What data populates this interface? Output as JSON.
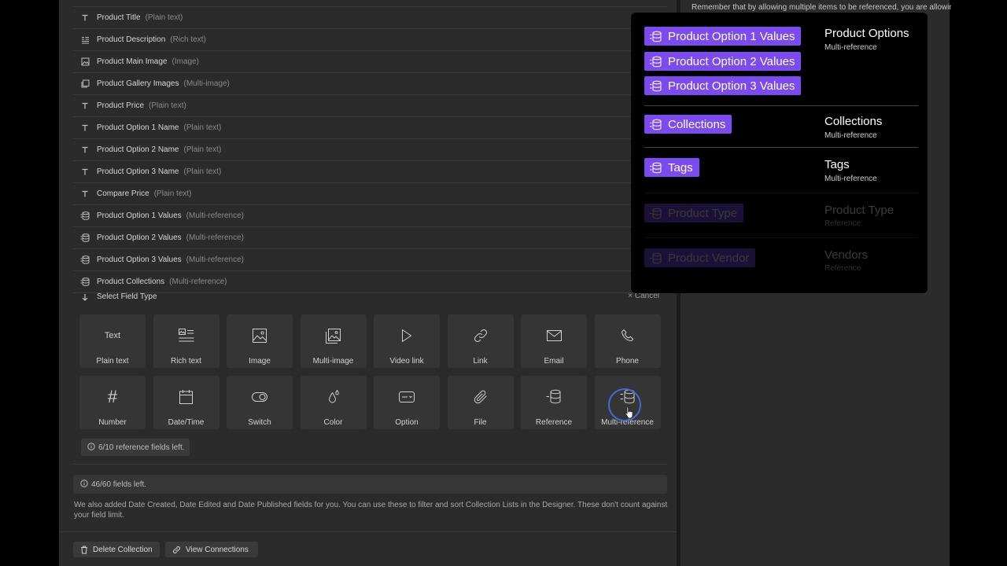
{
  "hint": "Remember that by allowing multiple items to be referenced, you are allowing ... design t",
  "fields": [
    {
      "icon": "text-icon",
      "name": "Product Title",
      "type": "(Plain text)"
    },
    {
      "icon": "rich-text-icon",
      "name": "Product Description",
      "type": "(Rich text)"
    },
    {
      "icon": "image-icon",
      "name": "Product Main Image",
      "type": "(Image)"
    },
    {
      "icon": "multi-image-icon",
      "name": "Product Gallery Images",
      "type": "(Multi-image)"
    },
    {
      "icon": "text-icon",
      "name": "Product Price",
      "type": "(Plain text)"
    },
    {
      "icon": "text-icon",
      "name": "Product Option 1 Name",
      "type": "(Plain text)"
    },
    {
      "icon": "text-icon",
      "name": "Product Option 2 Name",
      "type": "(Plain text)"
    },
    {
      "icon": "text-icon",
      "name": "Product Option 3 Name",
      "type": "(Plain text)"
    },
    {
      "icon": "text-icon",
      "name": "Compare Price",
      "type": "(Plain text)"
    },
    {
      "icon": "multi-reference-icon",
      "name": "Product Option 1 Values",
      "type": "(Multi-reference)"
    },
    {
      "icon": "multi-reference-icon",
      "name": "Product Option 2 Values",
      "type": "(Multi-reference)"
    },
    {
      "icon": "multi-reference-icon",
      "name": "Product Option 3 Values",
      "type": "(Multi-reference)"
    },
    {
      "icon": "multi-reference-icon",
      "name": "Product Collections",
      "type": "(Multi-reference)"
    }
  ],
  "select_field": {
    "label": "Select Field Type",
    "cancel": "Cancel",
    "cancel_icon": "×"
  },
  "field_types": [
    {
      "icon": "text-icon",
      "icon_text": "Text",
      "label": "Plain text"
    },
    {
      "icon": "rich-text-icon",
      "label": "Rich text"
    },
    {
      "icon": "image-icon",
      "label": "Image"
    },
    {
      "icon": "multi-image-icon",
      "label": "Multi-image"
    },
    {
      "icon": "video-link-icon",
      "label": "Video link"
    },
    {
      "icon": "link-icon",
      "label": "Link"
    },
    {
      "icon": "email-icon",
      "label": "Email"
    },
    {
      "icon": "phone-icon",
      "label": "Phone"
    },
    {
      "icon": "number-icon",
      "icon_text": "#",
      "label": "Number"
    },
    {
      "icon": "date-time-icon",
      "label": "Date/Time"
    },
    {
      "icon": "switch-icon",
      "label": "Switch"
    },
    {
      "icon": "color-icon",
      "label": "Color"
    },
    {
      "icon": "option-icon",
      "label": "Option"
    },
    {
      "icon": "file-icon",
      "label": "File"
    },
    {
      "icon": "reference-icon",
      "label": "Reference"
    },
    {
      "icon": "multi-reference-icon",
      "label": "Multi-reference"
    }
  ],
  "reference_note": "6/10 reference fields left.",
  "fields_left": "46/60 fields left.",
  "date_note": "We also added Date Created, Date Edited and Date Published fields for you. You can use these to filter and sort Collection Lists in the Designer. These don't count against your field limit.",
  "footer": {
    "delete": "Delete Collection",
    "connections": "View Connections"
  },
  "popup": {
    "groups": [
      {
        "pills": [
          "Product Option 1 Values",
          "Product Option 2 Values",
          "Product Option 3 Values"
        ],
        "title": "Product Options",
        "subtitle": "Multi-reference",
        "faded": false
      },
      {
        "pills": [
          "Collections"
        ],
        "title": "Collections",
        "subtitle": "Multi-reference",
        "faded": false
      },
      {
        "pills": [
          "Tags"
        ],
        "title": "Tags",
        "subtitle": "Multi-reference",
        "faded": false
      },
      {
        "pills": [
          "Product Type"
        ],
        "title": "Product Type",
        "subtitle": "Reference",
        "faded": true
      },
      {
        "pills": [
          "Product Vendor"
        ],
        "title": "Vendors",
        "subtitle": "Reference",
        "faded": true
      }
    ]
  },
  "colors": {
    "accent": "#7c4bf0",
    "panel": "#2b2b2b",
    "ring": "#3d6bd6"
  }
}
